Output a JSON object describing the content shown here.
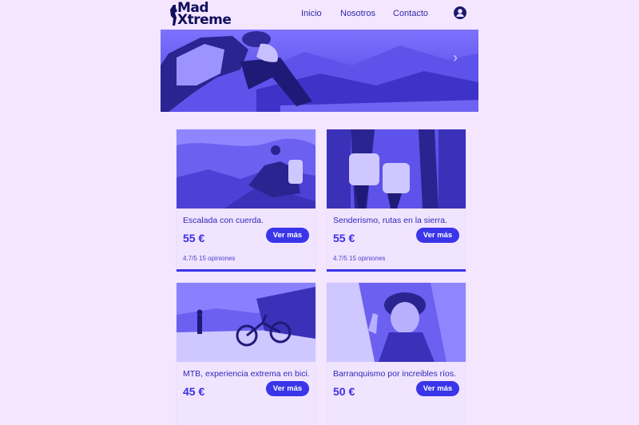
{
  "header": {
    "logo_line1": "Mad",
    "logo_line2": "Xtreme",
    "nav": [
      "Inicio",
      "Nosotros",
      "Contacto"
    ],
    "user_icon": "user-circle-icon"
  },
  "hero": {
    "next_icon": "chevron-right-icon"
  },
  "cards": [
    {
      "title": "Escalada con cuerda.",
      "price": "55 €",
      "button": "Ver más",
      "rating": "4.7/5 15 opiniones"
    },
    {
      "title": "Senderismo, rutas en la sierra.",
      "price": "55 €",
      "button": "Ver más",
      "rating": "4.7/5 15 opiniones"
    },
    {
      "title": "MTB, experiencia extrema en bici.",
      "price": "45 €",
      "button": "Ver más",
      "rating": ""
    },
    {
      "title": "Barranquismo por increibles ríos.",
      "price": "50 €",
      "button": "Ver más",
      "rating": ""
    }
  ],
  "colors": {
    "background": "#f5e6ff",
    "accent": "#3a35e8",
    "text": "#2e28b8"
  }
}
